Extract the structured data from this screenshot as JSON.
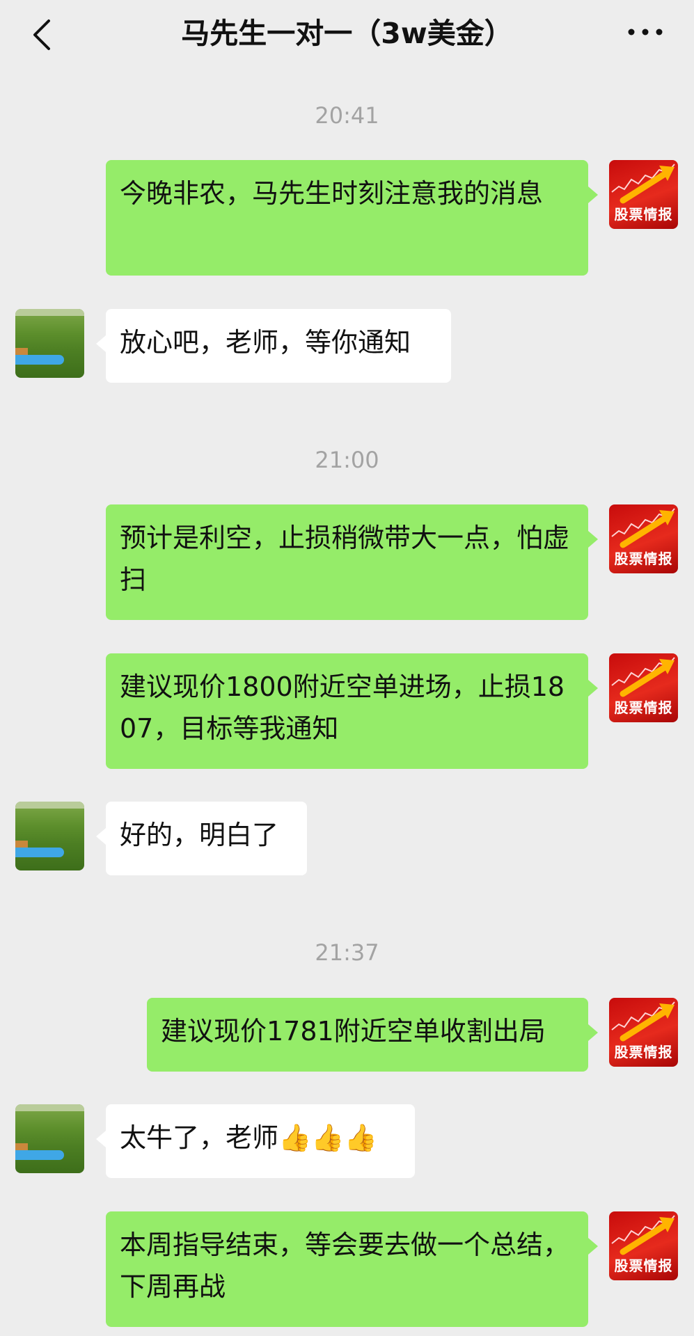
{
  "header": {
    "title": "马先生一对一（3w美金）"
  },
  "contact_avatar": {
    "logo_text": "股票情报"
  },
  "messages": {
    "t1": "20:41",
    "m1": "今晚非农，马先生时刻注意我的消息",
    "m2": "放心吧，老师，等你通知",
    "t2": "21:00",
    "m3": "预计是利空，止损稍微带大一点，怕虚扫",
    "m4": "建议现价1800附近空单进场，止损1807，目标等我通知",
    "m5": "好的，明白了",
    "t3": "21:37",
    "m6": "建议现价1781附近空单收割出局",
    "m7": "太牛了，老师",
    "m7_emoji": "👍👍👍",
    "m8": "本周指导结束，等会要去做一个总结，下周再战"
  },
  "colors": {
    "background": "#ededed",
    "outgoing_bubble": "#95ec69",
    "incoming_bubble": "#ffffff",
    "timestamp": "#a3a3a3"
  },
  "icons": {
    "back": "chevron-left-icon",
    "more": "more-dots-icon"
  }
}
